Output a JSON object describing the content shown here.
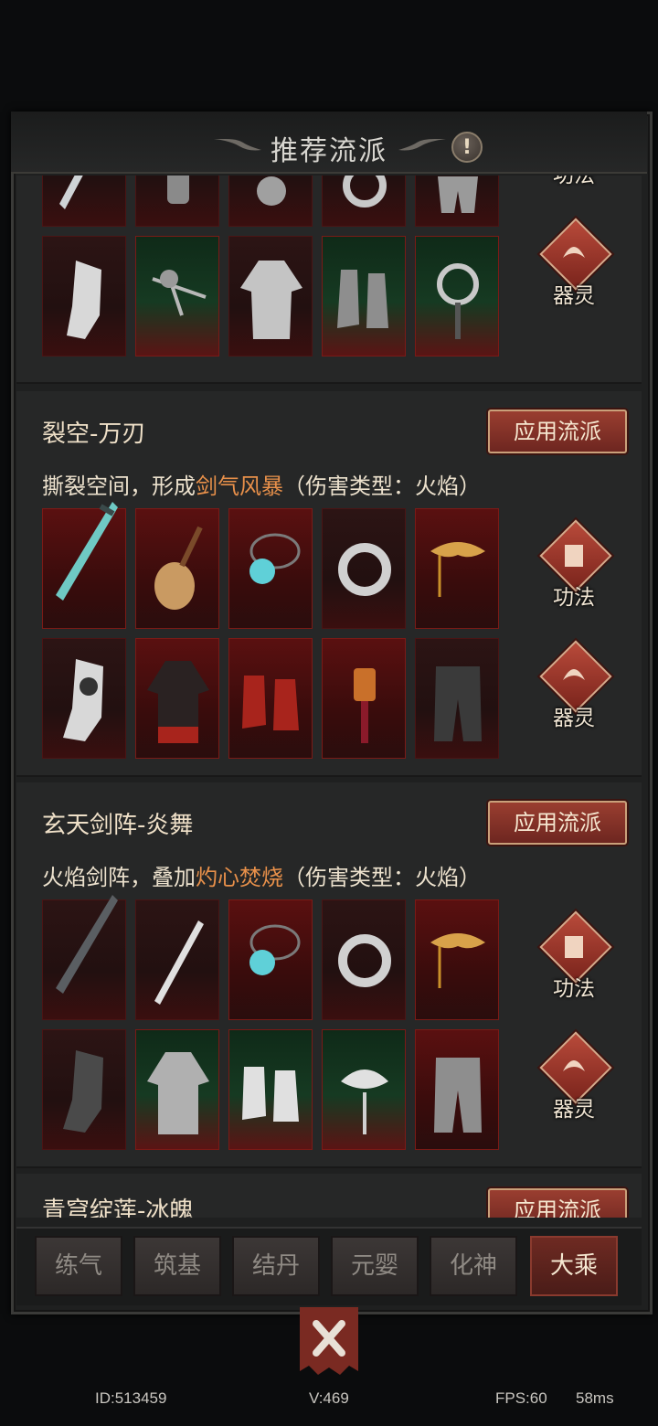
{
  "header": {
    "title": "推荐流派",
    "info_icon_text": "!"
  },
  "side_labels": {
    "gongfa": "功法",
    "qiling": "器灵"
  },
  "sections": [
    {
      "title": "",
      "desc": ""
    },
    {
      "title": "裂空-万刃",
      "apply_label": "应用流派",
      "desc_before": "撕裂空间，形成",
      "desc_highlight": "剑气风暴",
      "desc_after": "（伤害类型：火焰）"
    },
    {
      "title": "玄天剑阵-炎舞",
      "apply_label": "应用流派",
      "desc_before": "火焰剑阵，叠加",
      "desc_highlight": "灼心焚烧",
      "desc_after": "（伤害类型：火焰）"
    },
    {
      "title": "青穹绽莲-冰魄",
      "apply_label": "应用流派"
    }
  ],
  "tabs": [
    "练气",
    "筑基",
    "结丹",
    "元婴",
    "化神",
    "大乘"
  ],
  "active_tab": "大乘",
  "footer": {
    "id": "ID:513459",
    "version": "V:469",
    "fps": "FPS:60",
    "ping": "58ms"
  },
  "colors": {
    "highlight": "#e8904a",
    "accent_red": "#9a3e30",
    "panel_bg": "#262727"
  }
}
